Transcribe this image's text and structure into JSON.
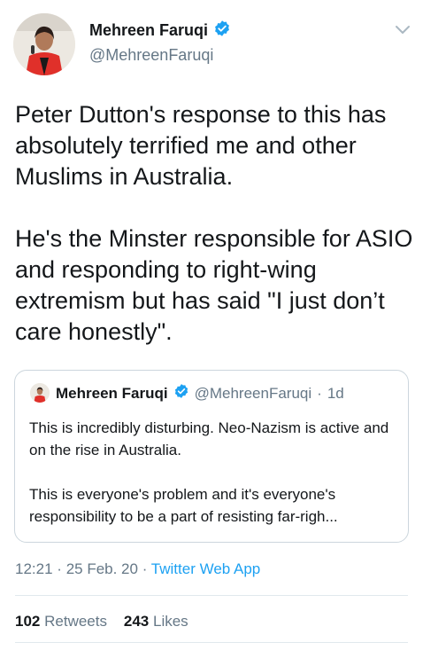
{
  "tweet": {
    "author": {
      "name": "Mehreen Faruqi",
      "handle": "@MehreenFaruqi",
      "verified": true
    },
    "text": "Peter Dutton's response to this has absolutely terrified me and other Muslims in Australia.\n\nHe's the Minster responsible for ASIO and responding to right-wing extremism but has said \"I just don’t care honestly\".",
    "quoted": {
      "name": "Mehreen Faruqi",
      "handle": "@MehreenFaruqi",
      "separator": "·",
      "time": "1d",
      "text": "This is incredibly disturbing. Neo-Nazism is active and on the rise in Australia.\n\nThis is everyone's problem and it's everyone's responsibility to be a part of resisting far-righ..."
    },
    "meta": {
      "time": "12:21",
      "sep1": "·",
      "date": "25 Feb. 20",
      "sep2": "·",
      "app": "Twitter Web App"
    },
    "stats": {
      "retweets_count": "102",
      "retweets_label": "Retweets",
      "likes_count": "243",
      "likes_label": "Likes"
    }
  },
  "colors": {
    "accent": "#1da1f2",
    "secondary_text": "#657786",
    "border": "#ccd6dd"
  },
  "icons": {
    "verified": "verified-badge-icon",
    "menu": "chevron-down-icon"
  }
}
